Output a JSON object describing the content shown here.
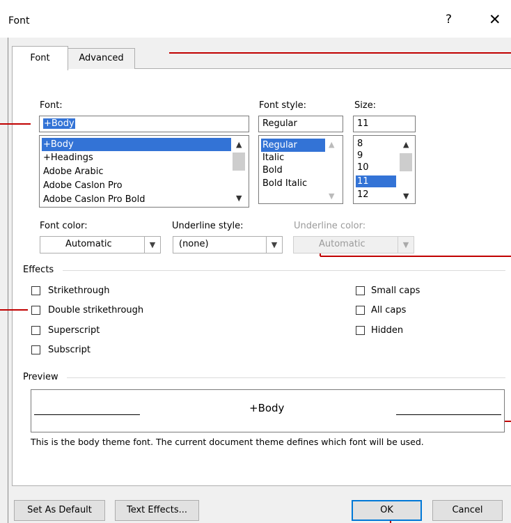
{
  "window": {
    "title": "Font",
    "help_glyph": "?",
    "close_glyph": "✕"
  },
  "tabs": {
    "font": "Font",
    "advanced": "Advanced"
  },
  "font": {
    "label": "Font:",
    "value": "+Body",
    "items": [
      "+Body",
      "+Headings",
      "Adobe Arabic",
      "Adobe Caslon Pro",
      "Adobe Caslon Pro Bold"
    ]
  },
  "font_style": {
    "label": "Font style:",
    "value": "Regular",
    "items": [
      "Regular",
      "Italic",
      "Bold",
      "Bold Italic"
    ]
  },
  "size": {
    "label": "Size:",
    "value": "11",
    "items": [
      "8",
      "9",
      "10",
      "11",
      "12"
    ]
  },
  "font_color": {
    "label": "Font color:",
    "value": "Automatic"
  },
  "underline_style": {
    "label": "Underline style:",
    "value": "(none)"
  },
  "underline_color": {
    "label": "Underline color:",
    "value": "Automatic"
  },
  "effects": {
    "label": "Effects",
    "strikethrough": "Strikethrough",
    "double_strikethrough": "Double strikethrough",
    "superscript": "Superscript",
    "subscript": "Subscript",
    "small_caps": "Small caps",
    "all_caps": "All caps",
    "hidden": "Hidden"
  },
  "preview": {
    "label": "Preview",
    "text": "+Body",
    "description": "This is the body theme font. The current document theme defines which font will be used."
  },
  "buttons": {
    "set_as_default": "Set As Default",
    "text_effects": "Text Effects...",
    "ok": "OK",
    "cancel": "Cancel"
  },
  "colors": {
    "selection": "#3373d6",
    "callout": "#c00000",
    "ok_border": "#0078d7"
  }
}
